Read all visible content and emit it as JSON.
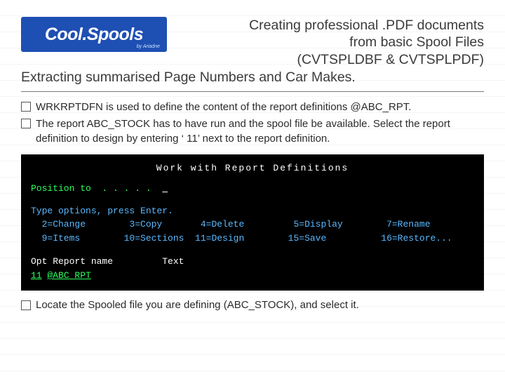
{
  "logo": {
    "main": "Cool.Spools",
    "sub": "by Ariadne"
  },
  "title": {
    "line1": "Creating professional .PDF documents",
    "line2": "from basic Spool Files",
    "line3": "(CVTSPLDBF & CVTSPLPDF)"
  },
  "subtitle": "Extracting summarised Page Numbers and Car Makes.",
  "bullets": [
    "WRKRPTDFN is used to define the content of the report definitions @ABC_RPT.",
    "The report ABC_STOCK has to have run and the spool file be available. Select the report definition to design by entering ‘ 11’ next to the report definition."
  ],
  "terminal": {
    "title": "Work with Report Definitions",
    "position_label": "Position to  . . . . .  ",
    "position_value": " ",
    "instruct": "Type options, press Enter.",
    "opts_row1": "  2=Change        3=Copy       4=Delete         5=Display        7=Rename",
    "opts_row2": "  9=Items        10=Sections  11=Design        15=Save          16=Restore...",
    "header_row": "Opt Report name         Text",
    "opt_input": "11",
    "report_name": "@ABC_RPT"
  },
  "trailer": "Locate the Spooled file you are defining (ABC_STOCK), and select it."
}
